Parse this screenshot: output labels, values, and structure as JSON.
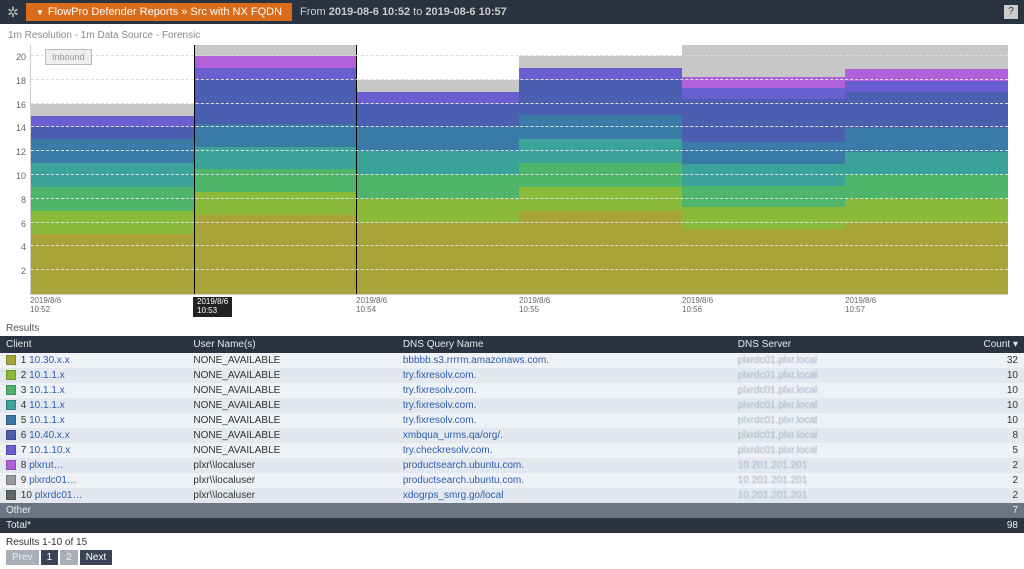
{
  "header": {
    "breadcrumb": "FlowPro Defender Reports » Src with NX FQDN",
    "range_prefix": "From ",
    "range_from": "2019-08-6 10:52",
    "range_to_word": " to ",
    "range_to": "2019-08-6 10:57"
  },
  "chart": {
    "subtitle": "1m Resolution - 1m Data Source - Forensic",
    "legend_btn": "Inbound",
    "ymax": 21,
    "yticks": [
      2,
      4,
      6,
      8,
      10,
      12,
      14,
      16,
      18,
      20
    ],
    "xcats": [
      "2019/8/6 10:52",
      "2019/8/6 10:53",
      "2019/8/6 10:54",
      "2019/8/6 10:55",
      "2019/8/6 10:56",
      "2019/8/6 10:57"
    ],
    "series_colors": [
      "#a8a43a",
      "#8bb93a",
      "#4fb56a",
      "#3ba39a",
      "#3a7aa6",
      "#4a5fb0",
      "#6a5fd0",
      "#b060d8",
      "#c7c7c7"
    ],
    "chart_data": {
      "type": "bar",
      "stacked": true,
      "categories": [
        "10:52",
        "10:53",
        "10:54",
        "10:55",
        "10:56",
        "10:57"
      ],
      "series": [
        {
          "name": "10.30.x.x",
          "values": [
            5,
            7,
            6,
            7,
            6,
            6
          ]
        },
        {
          "name": "10.1.1.x a",
          "values": [
            2,
            2,
            2,
            2,
            2,
            2
          ]
        },
        {
          "name": "10.1.1.x b",
          "values": [
            2,
            2,
            2,
            2,
            2,
            2
          ]
        },
        {
          "name": "10.1.1.x c",
          "values": [
            2,
            2,
            2,
            2,
            2,
            2
          ]
        },
        {
          "name": "10.1.1.x d",
          "values": [
            2,
            2,
            2,
            2,
            2,
            2
          ]
        },
        {
          "name": "10.40.x.x",
          "values": [
            1,
            4,
            2,
            3,
            4,
            3
          ]
        },
        {
          "name": "10.1.10.x",
          "values": [
            1,
            1,
            1,
            1,
            1,
            1
          ]
        },
        {
          "name": "plxrut…",
          "values": [
            0,
            1,
            0,
            0,
            1,
            1
          ]
        },
        {
          "name": "Other/gray",
          "values": [
            1,
            1,
            1,
            1,
            3,
            2
          ]
        }
      ],
      "ylabel": "",
      "xlabel": "",
      "ylim": [
        0,
        21
      ]
    }
  },
  "table": {
    "heading": "Results",
    "cols": [
      "Client",
      "User Name(s)",
      "DNS Query Name",
      "DNS Server",
      "Count ▾"
    ],
    "row_colors": [
      "#a8a43a",
      "#8bb93a",
      "#4fb56a",
      "#3ba39a",
      "#3a7aa6",
      "#4a5fb0",
      "#6a5fd0",
      "#b060d8",
      "#9a9a9a",
      "#666"
    ],
    "rows": [
      {
        "n": "1",
        "client": "10.30.x.x",
        "user": "NONE_AVAILABLE",
        "query": "bbbbb.s3.rrrrm.amazonaws.com.",
        "server": "plxrdc01.plxr.local",
        "count": "32"
      },
      {
        "n": "2",
        "client": "10.1.1.x",
        "user": "NONE_AVAILABLE",
        "query": "try.fixresolv.com.",
        "server": "plxrdc01.plxr.local",
        "count": "10"
      },
      {
        "n": "3",
        "client": "10.1.1.x",
        "user": "NONE_AVAILABLE",
        "query": "try.fixresolv.com.",
        "server": "plxrdc01.plxr.local",
        "count": "10"
      },
      {
        "n": "4",
        "client": "10.1.1.x",
        "user": "NONE_AVAILABLE",
        "query": "try.fixresolv.com.",
        "server": "plxrdc01.plxr.local",
        "count": "10"
      },
      {
        "n": "5",
        "client": "10.1.1.x",
        "user": "NONE_AVAILABLE",
        "query": "try.fixresolv.com.",
        "server": "plxrdc01.plxr.local",
        "count": "10"
      },
      {
        "n": "6",
        "client": "10.40.x.x",
        "user": "NONE_AVAILABLE",
        "query": "xmbqua_urms.qa/org/.",
        "server": "plxrdc01.plxr.local",
        "count": "8"
      },
      {
        "n": "7",
        "client": "10.1.10.x",
        "user": "NONE_AVAILABLE",
        "query": "try.checkresolv.com.",
        "server": "plxrdc01.plxr.local",
        "count": "5"
      },
      {
        "n": "8",
        "client": "plxrut…",
        "user": "plxr\\\\localuser",
        "query": "productsearch.ubuntu.com.",
        "server": "10.201.201.201",
        "count": "2"
      },
      {
        "n": "9",
        "client": "plxrdc01…",
        "user": "plxr\\\\localuser",
        "query": "productsearch.ubuntu.com.",
        "server": "10.201.201.201",
        "count": "2"
      },
      {
        "n": "10",
        "client": "plxrdc01…",
        "user": "plxr\\\\localuser",
        "query": "xdogrps_smrg.go/local",
        "server": "10.201.201.201",
        "count": "2"
      }
    ],
    "other_label": "Other",
    "other_count": "7",
    "total_label": "Total*",
    "total_count": "98"
  },
  "footer": {
    "summary": "Results 1-10 of 15",
    "prev": "Prev",
    "p1": "1",
    "p2": "2",
    "next": "Next"
  }
}
